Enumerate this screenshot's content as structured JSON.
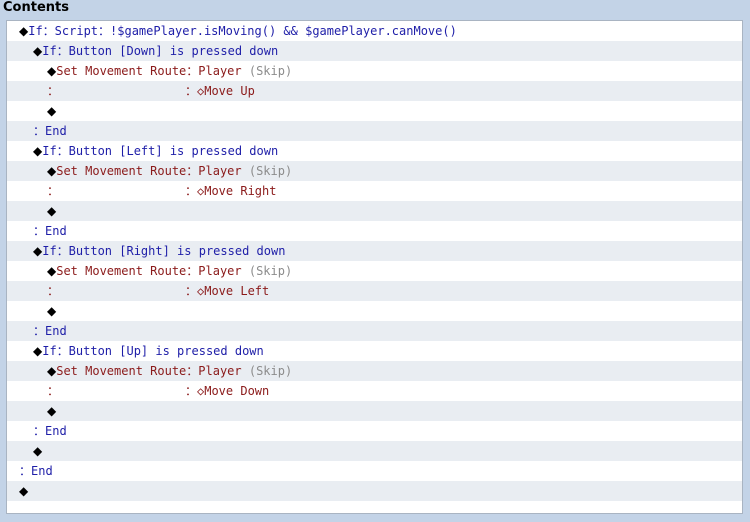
{
  "panel": {
    "title": "Contents"
  },
  "lines": [
    {
      "indent": 0,
      "parts": [
        {
          "t": "◆",
          "c": "d"
        },
        {
          "t": "If：Script：!$gamePlayer.isMoving() && $gamePlayer.canMove()",
          "c": "k"
        }
      ]
    },
    {
      "indent": 1,
      "parts": [
        {
          "t": "◆",
          "c": "d"
        },
        {
          "t": "If：Button [Down] is pressed down",
          "c": "k"
        }
      ]
    },
    {
      "indent": 2,
      "parts": [
        {
          "t": "◆",
          "c": "d"
        },
        {
          "t": "Set Movement Route：",
          "c": "c"
        },
        {
          "t": "Player ",
          "c": "c"
        },
        {
          "t": "(Skip)",
          "c": "s"
        }
      ]
    },
    {
      "indent": 2,
      "parts": [
        {
          "t": "：",
          "c": "c"
        }
      ],
      "cont": [
        {
          "t": "：◇Move Up",
          "c": "c"
        }
      ]
    },
    {
      "indent": 2,
      "parts": [
        {
          "t": "◆",
          "c": "d"
        }
      ]
    },
    {
      "indent": 1,
      "parts": [
        {
          "t": "：End",
          "c": "k"
        }
      ]
    },
    {
      "indent": 1,
      "parts": [
        {
          "t": "◆",
          "c": "d"
        },
        {
          "t": "If：Button [Left] is pressed down",
          "c": "k"
        }
      ]
    },
    {
      "indent": 2,
      "parts": [
        {
          "t": "◆",
          "c": "d"
        },
        {
          "t": "Set Movement Route：",
          "c": "c"
        },
        {
          "t": "Player ",
          "c": "c"
        },
        {
          "t": "(Skip)",
          "c": "s"
        }
      ]
    },
    {
      "indent": 2,
      "parts": [
        {
          "t": "：",
          "c": "c"
        }
      ],
      "cont": [
        {
          "t": "：◇Move Right",
          "c": "c"
        }
      ]
    },
    {
      "indent": 2,
      "parts": [
        {
          "t": "◆",
          "c": "d"
        }
      ]
    },
    {
      "indent": 1,
      "parts": [
        {
          "t": "：End",
          "c": "k"
        }
      ]
    },
    {
      "indent": 1,
      "parts": [
        {
          "t": "◆",
          "c": "d"
        },
        {
          "t": "If：Button [Right] is pressed down",
          "c": "k"
        }
      ]
    },
    {
      "indent": 2,
      "parts": [
        {
          "t": "◆",
          "c": "d"
        },
        {
          "t": "Set Movement Route：",
          "c": "c"
        },
        {
          "t": "Player ",
          "c": "c"
        },
        {
          "t": "(Skip)",
          "c": "s"
        }
      ]
    },
    {
      "indent": 2,
      "parts": [
        {
          "t": "：",
          "c": "c"
        }
      ],
      "cont": [
        {
          "t": "：◇Move Left",
          "c": "c"
        }
      ]
    },
    {
      "indent": 2,
      "parts": [
        {
          "t": "◆",
          "c": "d"
        }
      ]
    },
    {
      "indent": 1,
      "parts": [
        {
          "t": "：End",
          "c": "k"
        }
      ]
    },
    {
      "indent": 1,
      "parts": [
        {
          "t": "◆",
          "c": "d"
        },
        {
          "t": "If：Button [Up] is pressed down",
          "c": "k"
        }
      ]
    },
    {
      "indent": 2,
      "parts": [
        {
          "t": "◆",
          "c": "d"
        },
        {
          "t": "Set Movement Route：",
          "c": "c"
        },
        {
          "t": "Player ",
          "c": "c"
        },
        {
          "t": "(Skip)",
          "c": "s"
        }
      ]
    },
    {
      "indent": 2,
      "parts": [
        {
          "t": "：",
          "c": "c"
        }
      ],
      "cont": [
        {
          "t": "：◇Move Down",
          "c": "c"
        }
      ]
    },
    {
      "indent": 2,
      "parts": [
        {
          "t": "◆",
          "c": "d"
        }
      ]
    },
    {
      "indent": 1,
      "parts": [
        {
          "t": "：End",
          "c": "k"
        }
      ]
    },
    {
      "indent": 1,
      "parts": [
        {
          "t": "◆",
          "c": "d"
        }
      ]
    },
    {
      "indent": 0,
      "parts": [
        {
          "t": "：End",
          "c": "k"
        }
      ]
    },
    {
      "indent": 0,
      "parts": [
        {
          "t": "◆",
          "c": "d"
        }
      ]
    }
  ]
}
